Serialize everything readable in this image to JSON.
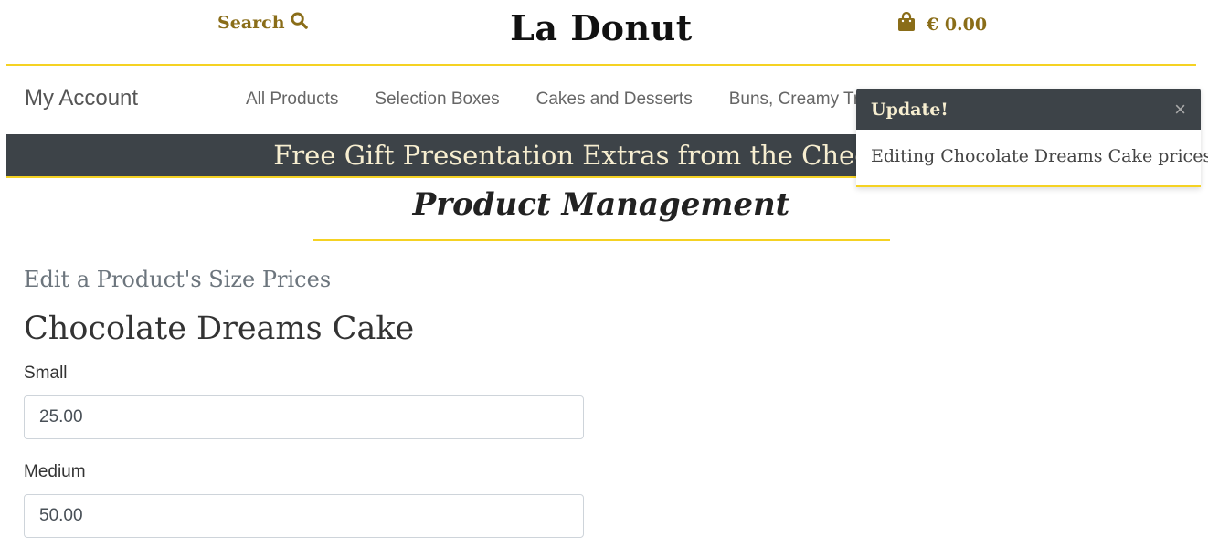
{
  "header": {
    "search_label": "Search",
    "brand": "La Donut",
    "basket_total": "€ 0.00"
  },
  "nav": {
    "my_account": "My Account",
    "items": [
      {
        "label": "All Products"
      },
      {
        "label": "Selection Boxes"
      },
      {
        "label": "Cakes and Desserts"
      },
      {
        "label": "Buns, Creamy Treats"
      }
    ]
  },
  "banner": {
    "text": "Free Gift Presentation Extras from the Checkout"
  },
  "page": {
    "title": "Product Management",
    "subtitle": "Edit a Product's Size Prices",
    "product_name": "Chocolate Dreams Cake",
    "fields": [
      {
        "label": "Small",
        "value": "25.00"
      },
      {
        "label": "Medium",
        "value": "50.00"
      }
    ]
  },
  "toast": {
    "title": "Update!",
    "close": "×",
    "message": "Editing Chocolate Dreams Cake prices"
  },
  "colors": {
    "accent": "#f5d223",
    "gold_text": "#8a6d18",
    "dark_bar": "#3d4348"
  }
}
